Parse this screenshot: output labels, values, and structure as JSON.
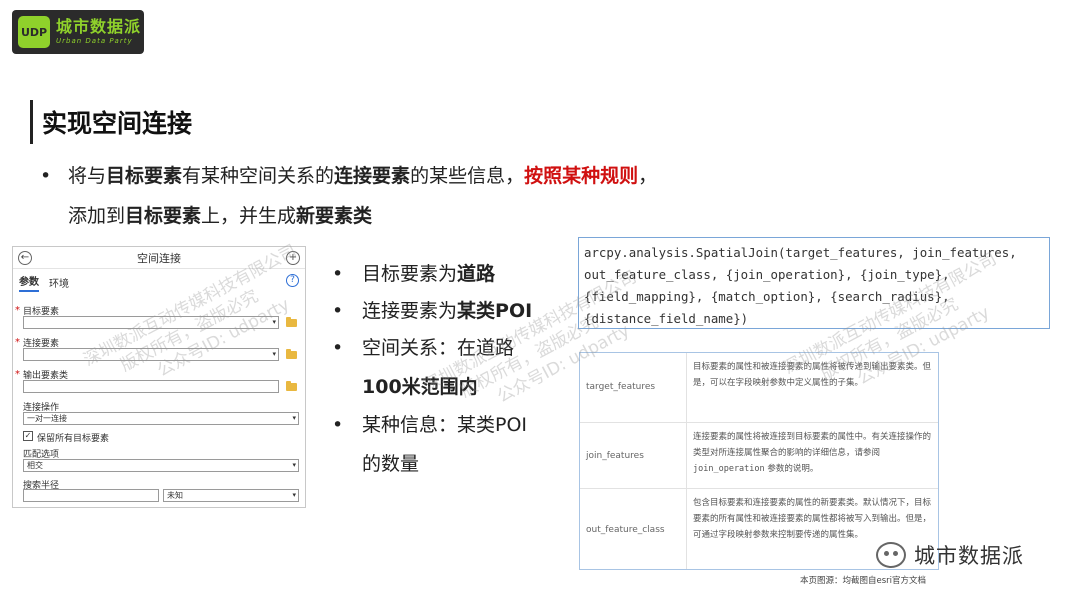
{
  "logo": {
    "cn": "城市数据派",
    "en": "Urban Data Party",
    "mark": "UDP"
  },
  "title": "实现空间连接",
  "intro": {
    "bullet": "•",
    "l1_a": "将与",
    "l1_b": "目标要素",
    "l1_c": "有某种空间关系的",
    "l1_d": "连接要素",
    "l1_e": "的某些信息，",
    "l1_f": "按照某种规则",
    "l1_g": "，",
    "l2_a": "添加到",
    "l2_b": "目标要素",
    "l2_c": "上，并生成",
    "l2_d": "新要素类"
  },
  "dialog": {
    "title": "空间连接",
    "tabs": [
      "参数",
      "环境"
    ],
    "help": "?",
    "required_mark": "*",
    "target_label": "目标要素",
    "join_label": "连接要素",
    "output_label": "输出要素类",
    "operation_label": "连接操作",
    "operation_value": "一对一连接",
    "keep_label": "保留所有目标要素",
    "keep_check": "✓",
    "match_label": "匹配选项",
    "match_value": "相交",
    "radius_label": "搜索半径",
    "radius_unit": "未知",
    "dropdown_arrow": "▾",
    "back_icon": "←",
    "add_icon": "+"
  },
  "points": {
    "bullet": "•",
    "p1_a": "目标要素为",
    "p1_b": "道路",
    "p2_a": "连接要素为",
    "p2_b": "某类POI",
    "p3_a": "空间关系：在道路",
    "p3_b": "100米范围内",
    "p4_a": "某种信息：某类POI",
    "p4_b": "的数量"
  },
  "code": "arcpy.analysis.SpatialJoin(target_features, join_features,\nout_feature_class, {join_operation}, {join_type},\n{field_mapping}, {match_option}, {search_radius},\n{distance_field_name})",
  "params": [
    {
      "name": "target_features",
      "desc": "目标要素的属性和被连接要素的属性将被传递到输出要素类。但是，可以在字段映射参数中定义属性的子集。"
    },
    {
      "name": "join_features",
      "desc_a": "连接要素的属性将被连接到目标要素的属性中。有关连接操作的类型对所连接属性聚合的影响的详细信息，请参阅 ",
      "desc_code": "join_operation",
      "desc_b": " 参数的说明。"
    },
    {
      "name": "out_feature_class",
      "desc": "包含目标要素和连接要素的属性的新要素类。默认情况下，目标要素的所有属性和被连接要素的属性都将被写入到输出。但是，可通过字段映射参数来控制要传递的属性集。"
    }
  ],
  "watermark": {
    "l1": "深圳数派互动传媒科技有限公司",
    "l2": "版权所有，盗版必究",
    "l3": "公众号ID: udparty"
  },
  "brand": "城市数据派",
  "source": "本页图源：均截图自esri官方文档",
  "colors": {
    "accent_red": "#d01010",
    "logo_green": "#8fd12b",
    "tab_blue": "#2e6fd6",
    "code_border": "#7aa6d8"
  }
}
